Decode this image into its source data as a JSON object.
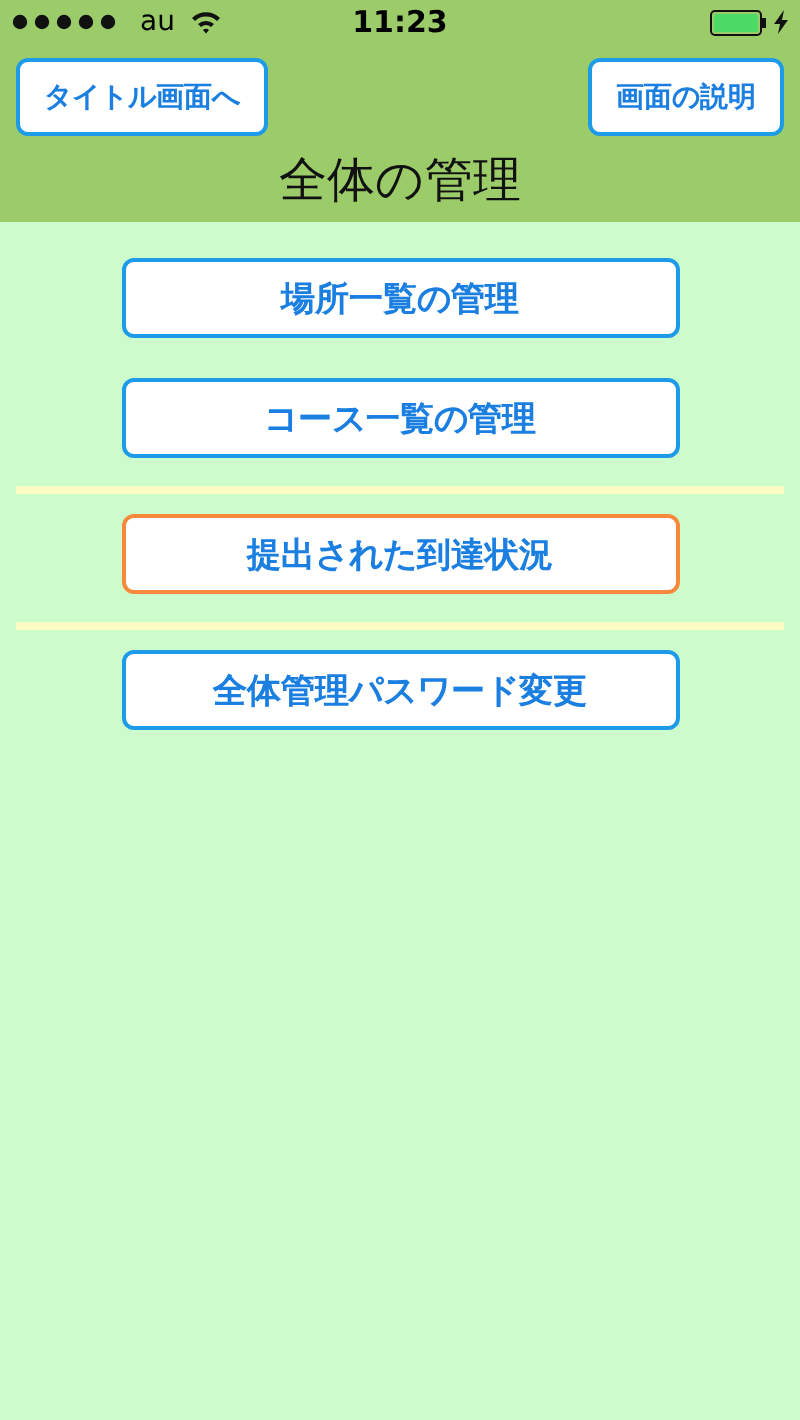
{
  "status_bar": {
    "carrier": "au",
    "time": "11:23"
  },
  "header": {
    "buttons": [
      {
        "label": "タイトル画面へ"
      },
      {
        "label": "画面の説明"
      }
    ],
    "title": "全体の管理"
  },
  "menu": [
    {
      "kind": "button",
      "label": "場所一覧の管理",
      "color": "#1e9be8"
    },
    {
      "kind": "button",
      "label": "コース一覧の管理",
      "color": "#1e9be8"
    },
    {
      "kind": "divider"
    },
    {
      "kind": "button",
      "label": "提出された到達状況",
      "color": "#f58a3c"
    },
    {
      "kind": "divider"
    },
    {
      "kind": "button",
      "label": "全体管理パスワード変更",
      "color": "#1e9be8"
    }
  ]
}
